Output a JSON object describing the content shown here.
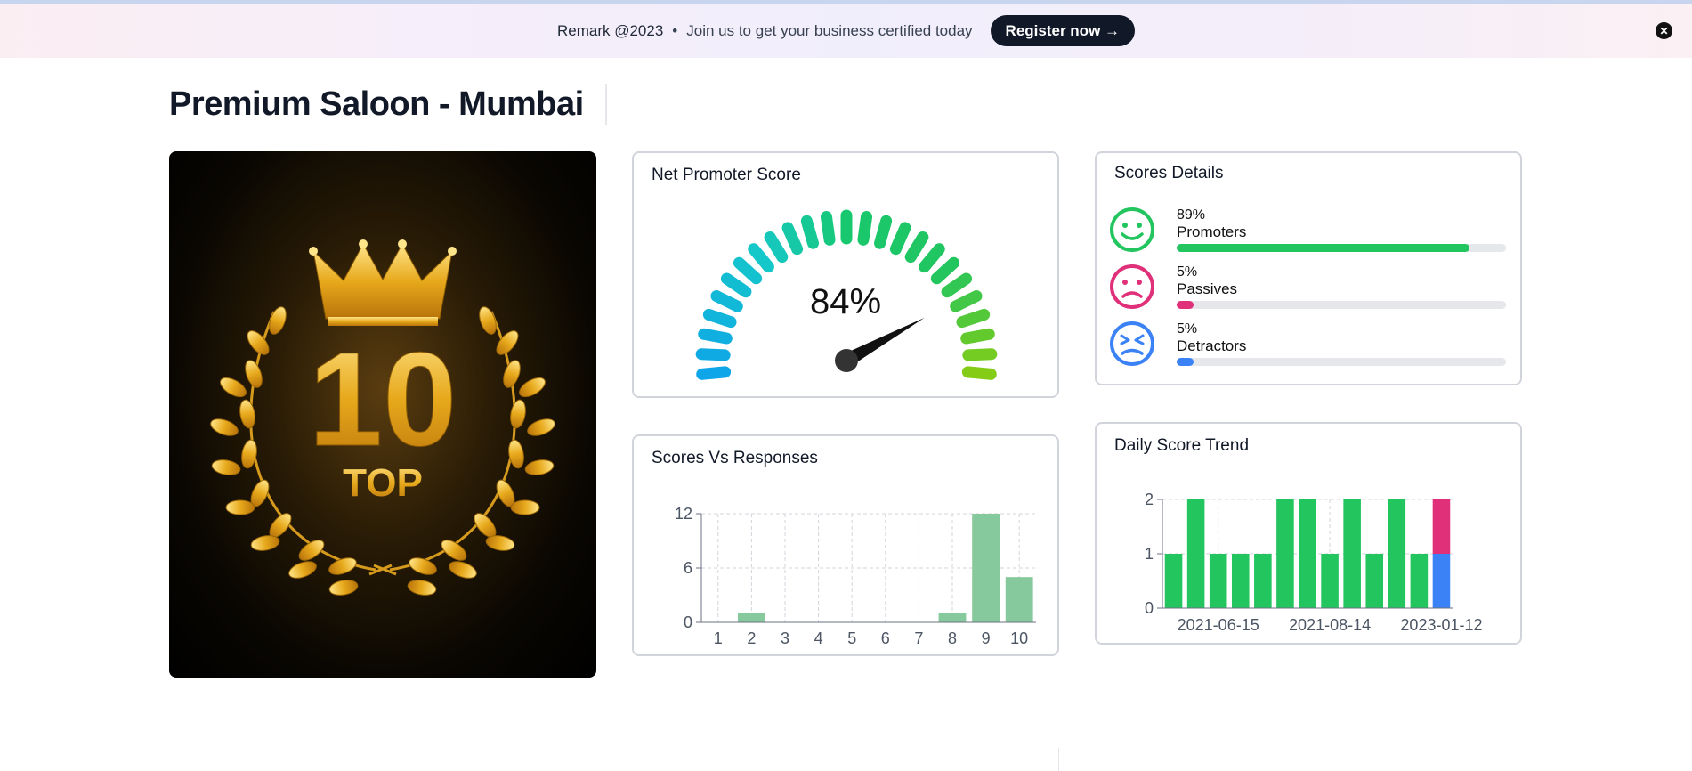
{
  "banner": {
    "brand": "Remark @2023",
    "separator": "•",
    "message": "Join us to get your business certified today",
    "button_label": "Register now →",
    "close_icon": "close-icon"
  },
  "page": {
    "title": "Premium Saloon - Mumbai"
  },
  "hero_badge": {
    "number": "10",
    "word": "TOP"
  },
  "nps_card": {
    "title": "Net Promoter Score",
    "value_label": "84%",
    "value": 84
  },
  "scores_details": {
    "title": "Scores Details",
    "items": [
      {
        "percent": "89%",
        "label": "Promoters",
        "value": 89,
        "color": "#22c55e",
        "icon": "smile-face-icon"
      },
      {
        "percent": "5%",
        "label": "Passives",
        "value": 5,
        "color": "#e0307a",
        "icon": "neutral-face-icon"
      },
      {
        "percent": "5%",
        "label": "Detractors",
        "value": 5,
        "color": "#3b82f6",
        "icon": "angry-face-icon"
      }
    ]
  },
  "scores_vs_responses": {
    "title": "Scores Vs Responses"
  },
  "daily_score_trend": {
    "title": "Daily Score Trend"
  },
  "chart_data": [
    {
      "type": "bar",
      "title": "Scores Vs Responses",
      "categories": [
        "1",
        "2",
        "3",
        "4",
        "5",
        "6",
        "7",
        "8",
        "9",
        "10"
      ],
      "values": [
        0,
        1,
        0,
        0,
        0,
        0,
        0,
        1,
        12,
        5
      ],
      "yticks": [
        0,
        6,
        12
      ],
      "ylim": [
        0,
        12
      ],
      "color": "#86c99c",
      "grid": true
    },
    {
      "type": "bar",
      "title": "Daily Score Trend",
      "stacked": true,
      "categories": [
        "",
        "",
        "",
        "",
        "",
        "",
        "",
        "",
        "",
        "",
        "",
        "",
        ""
      ],
      "xtick_labels": [
        "2021-06-15",
        "2021-08-14",
        "2023-01-12"
      ],
      "series": [
        {
          "color": "#22c55e",
          "values": [
            1,
            2,
            1,
            1,
            1,
            2,
            2,
            1,
            2,
            1,
            2,
            1,
            0
          ]
        },
        {
          "color": "#3b82f6",
          "values": [
            0,
            0,
            0,
            0,
            0,
            0,
            0,
            0,
            0,
            0,
            0,
            0,
            1
          ]
        },
        {
          "color": "#e0307a",
          "values": [
            0,
            0,
            0,
            0,
            0,
            0,
            0,
            0,
            0,
            0,
            0,
            0,
            1
          ]
        }
      ],
      "yticks": [
        0,
        1,
        2
      ],
      "ylim": [
        0,
        2
      ],
      "grid": true
    }
  ]
}
